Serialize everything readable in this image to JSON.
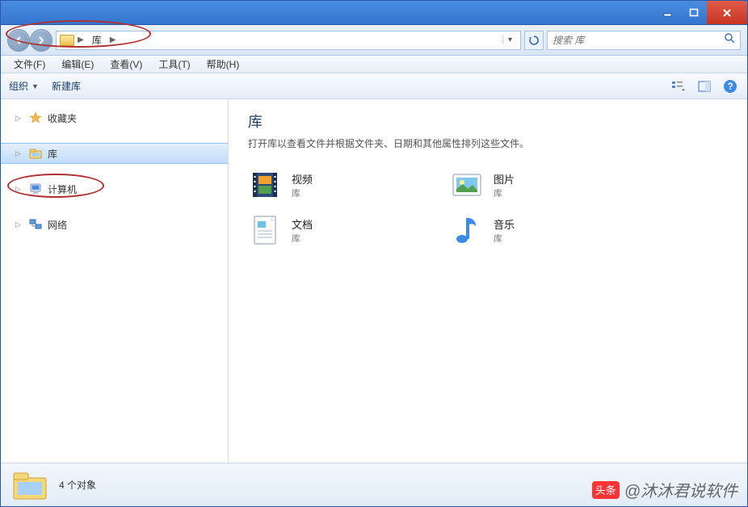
{
  "breadcrumb": {
    "root": "库"
  },
  "search": {
    "placeholder": "搜索 库"
  },
  "menu": {
    "file": "文件(F)",
    "edit": "编辑(E)",
    "view": "查看(V)",
    "tools": "工具(T)",
    "help": "帮助(H)"
  },
  "toolbar": {
    "organize": "组织",
    "newlib": "新建库"
  },
  "sidebar": {
    "favorites": "收藏夹",
    "libraries": "库",
    "computer": "计算机",
    "network": "网络"
  },
  "main": {
    "title": "库",
    "subtitle": "打开库以查看文件并根据文件夹、日期和其他属性排列这些文件。",
    "libs": {
      "videos": {
        "name": "视频",
        "type": "库"
      },
      "pictures": {
        "name": "图片",
        "type": "库"
      },
      "documents": {
        "name": "文档",
        "type": "库"
      },
      "music": {
        "name": "音乐",
        "type": "库"
      }
    }
  },
  "status": {
    "count": "4 个对象"
  },
  "watermark": {
    "prefix": "头条",
    "text": "@沐沐君说软件"
  }
}
